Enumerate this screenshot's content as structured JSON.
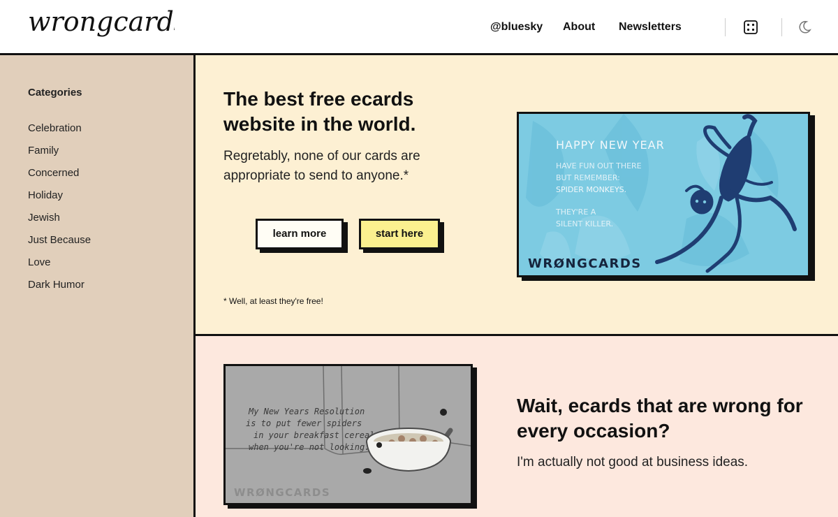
{
  "header": {
    "logo_text": "wrongcards",
    "nav": {
      "bluesky": "@bluesky",
      "about": "About",
      "newsletters": "Newsletters"
    },
    "icons": [
      "dice-icon",
      "moon-icon"
    ]
  },
  "sidebar": {
    "title": "Categories",
    "items": [
      {
        "label": "Celebration"
      },
      {
        "label": "Family"
      },
      {
        "label": "Concerned"
      },
      {
        "label": "Holiday"
      },
      {
        "label": "Jewish"
      },
      {
        "label": "Just Because"
      },
      {
        "label": "Love"
      },
      {
        "label": "Dark Humor"
      }
    ]
  },
  "hero": {
    "title": "The best free ecards website in the world.",
    "subtitle": "Regretably, none of our cards are appropriate to send to anyone.*",
    "learn_more": "learn more",
    "start_here": "start here",
    "footnote": "* Well, at least they're free!",
    "card": {
      "line1": "HAPPY NEW YEAR",
      "line2": "HAVE FUN OUT THERE",
      "line3": "BUT REMEMBER:",
      "line4": "SPIDER MONKEYS.",
      "line5": "THEY'RE A",
      "line6": "SILENT KILLER.",
      "brand": "WRØNGCARDS"
    }
  },
  "second": {
    "title": "Wait, ecards that are wrong for every occasion?",
    "subtitle": "I'm actually not good at business ideas.",
    "card": {
      "line1": "My New Years Resolution",
      "line2": "is to put fewer spiders",
      "line3": "in your breakfast cereal",
      "line4": "when you're not looking.",
      "brand": "WRØNGCARDS"
    }
  },
  "colors": {
    "hero_bg": "#fdf0d3",
    "second_bg": "#fde8de",
    "sidebar_bg": "#e1cfbb",
    "start_btn": "#fbf08f",
    "card1_bg": "#7dcbe2",
    "card2_bg": "#a9a9a9"
  }
}
